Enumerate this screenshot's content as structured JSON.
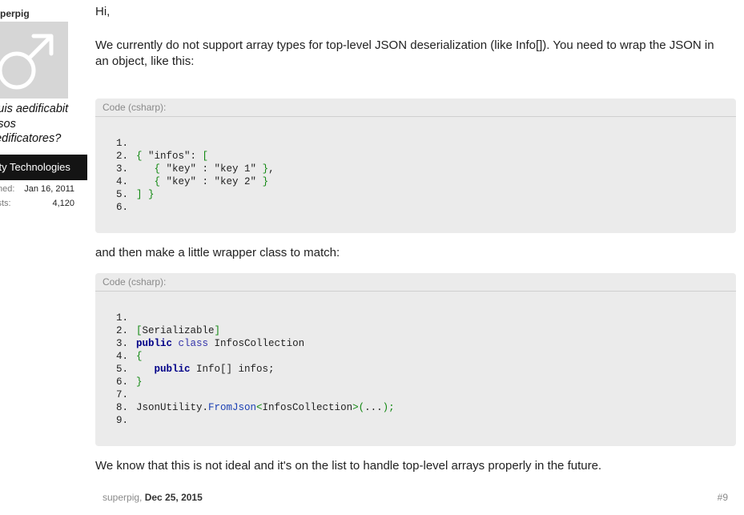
{
  "user": {
    "name": "superpig",
    "title_line1": "Quis aedificabit",
    "title_line2": "ipsos",
    "title_line3": "aedificatores?",
    "banner": "Unity Technologies",
    "joined_label": "Joined:",
    "joined_value": "Jan 16, 2011",
    "posts_label": "Posts:",
    "posts_value": "4,120"
  },
  "message": {
    "greeting": "Hi,",
    "intro": "We currently do not support array types for top-level JSON deserialization (like Info[]). You need to wrap the JSON in an object, like this:",
    "between": "and then make a little wrapper class to match:",
    "outro": "We know that this is not ideal and it's on the list to handle top-level arrays properly in the future."
  },
  "code1": {
    "title": "Code (csharp):",
    "lines": [
      "",
      "{ \"infos\": [",
      "   { \"key\" : \"key 1\" },",
      "   { \"key\" : \"key 2\" }",
      "] }",
      ""
    ]
  },
  "code2": {
    "title": "Code (csharp):",
    "lines": [
      "",
      "[Serializable]",
      "public class InfosCollection",
      "{",
      "   public Info[] infos;",
      "}",
      "",
      "JsonUtility.FromJson<InfosCollection>(...);",
      ""
    ]
  },
  "footer": {
    "author": "superpig",
    "separator": ", ",
    "date": "Dec 25, 2015",
    "post_number": "#9"
  }
}
